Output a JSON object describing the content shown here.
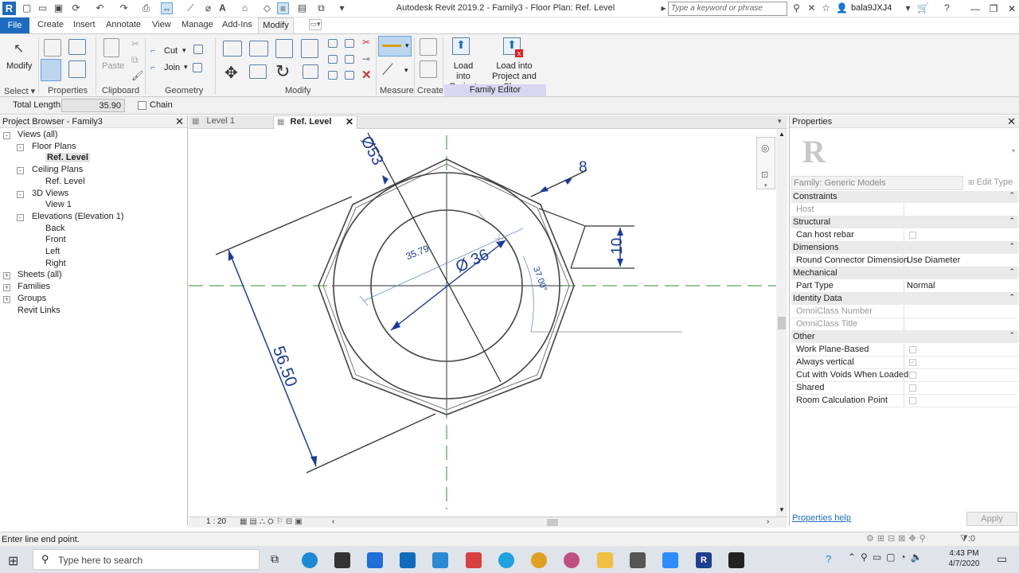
{
  "titlebar": {
    "title": "Autodesk Revit 2019.2 - Family3 - Floor Plan: Ref. Level",
    "search_placeholder": "Type a keyword or phrase",
    "user": "bala9JXJ4"
  },
  "tabs": [
    "File",
    "Create",
    "Insert",
    "Annotate",
    "View",
    "Manage",
    "Add-Ins",
    "Modify"
  ],
  "ribbon": {
    "modify_label": "Modify",
    "paste_label": "Paste",
    "cut_label": "Cut",
    "join_label": "Join",
    "load_into_project": [
      "Load into",
      "Project"
    ],
    "load_into_project_close": [
      "Load into",
      "Project and Close"
    ],
    "panels": {
      "select": "Select",
      "properties": "Properties",
      "clipboard": "Clipboard",
      "geometry": "Geometry",
      "modify": "Modify",
      "measure": "Measure",
      "create": "Create",
      "family_editor": "Family Editor"
    }
  },
  "options_bar": {
    "total_length_label": "Total Length:",
    "total_length_value": "35.90",
    "chain_label": "Chain"
  },
  "project_browser": {
    "title": "Project Browser - Family3",
    "items": [
      {
        "label": "Views (all)",
        "level": 0,
        "toggle": "-"
      },
      {
        "label": "Floor Plans",
        "level": 1,
        "toggle": "-"
      },
      {
        "label": "Ref. Level",
        "level": 2,
        "toggle": "",
        "bold": true
      },
      {
        "label": "Ceiling Plans",
        "level": 1,
        "toggle": "-"
      },
      {
        "label": "Ref. Level",
        "level": 2,
        "toggle": ""
      },
      {
        "label": "3D Views",
        "level": 1,
        "toggle": "-"
      },
      {
        "label": "View 1",
        "level": 2,
        "toggle": ""
      },
      {
        "label": "Elevations (Elevation 1)",
        "level": 1,
        "toggle": "-"
      },
      {
        "label": "Back",
        "level": 2,
        "toggle": ""
      },
      {
        "label": "Front",
        "level": 2,
        "toggle": ""
      },
      {
        "label": "Left",
        "level": 2,
        "toggle": ""
      },
      {
        "label": "Right",
        "level": 2,
        "toggle": ""
      },
      {
        "label": "Sheets (all)",
        "level": 0,
        "toggle": "+"
      },
      {
        "label": "Families",
        "level": 0,
        "toggle": "+"
      },
      {
        "label": "Groups",
        "level": 0,
        "toggle": "+"
      },
      {
        "label": "Revit Links",
        "level": 0,
        "toggle": ""
      }
    ]
  },
  "view_tabs": {
    "tab1": "Level 1",
    "tab2": "Ref. Level"
  },
  "drawing": {
    "dim_53": "Ø53",
    "dim_8": "8",
    "dim_10": "10",
    "dim_3579": "35.79",
    "dim_36": "Ø 36",
    "dim_angle": "37.00°",
    "dim_5650": "56.50"
  },
  "view_control": {
    "scale": "1 : 20"
  },
  "properties": {
    "title": "Properties",
    "family_selector": "Family: Generic Models",
    "edit_type": "Edit Type",
    "help_link": "Properties help",
    "apply": "Apply",
    "sections": [
      {
        "name": "Constraints",
        "rows": [
          {
            "name": "Host",
            "value": "",
            "disabled": true
          }
        ]
      },
      {
        "name": "Structural",
        "rows": [
          {
            "name": "Can host rebar",
            "checkbox": true
          }
        ]
      },
      {
        "name": "Dimensions",
        "rows": [
          {
            "name": "Round Connector Dimension",
            "value": "Use Diameter"
          }
        ]
      },
      {
        "name": "Mechanical",
        "rows": [
          {
            "name": "Part Type",
            "value": "Normal"
          }
        ]
      },
      {
        "name": "Identity Data",
        "rows": [
          {
            "name": "OmniClass Number",
            "value": "",
            "disabled": true
          },
          {
            "name": "OmniClass Title",
            "value": "",
            "disabled": true
          }
        ]
      },
      {
        "name": "Other",
        "rows": [
          {
            "name": "Work Plane-Based",
            "checkbox": true
          },
          {
            "name": "Always vertical",
            "checkbox": true,
            "checked": true
          },
          {
            "name": "Cut with Voids When Loaded",
            "checkbox": true
          },
          {
            "name": "Shared",
            "checkbox": true
          },
          {
            "name": "Room Calculation Point",
            "checkbox": true
          }
        ]
      }
    ]
  },
  "status": {
    "message": "Enter line end point.",
    "filter_count": ":0"
  },
  "taskbar": {
    "search_placeholder": "Type here to search",
    "time": "4:43 PM",
    "date": "4/7/2020"
  },
  "colors": {
    "file_tab": "#1d6bbf",
    "dimension_blue": "#1a3a9a",
    "refline_green": "#2e8b2e"
  }
}
